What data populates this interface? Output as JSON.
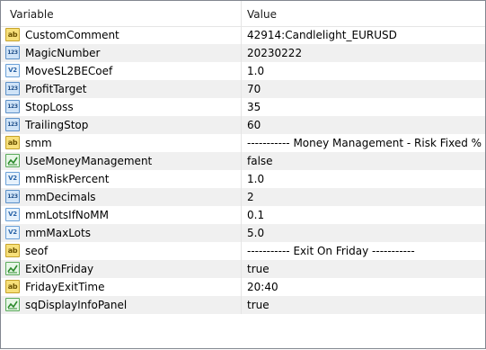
{
  "header": {
    "variable": "Variable",
    "value": "Value"
  },
  "rows": [
    {
      "icon": "string-icon",
      "type": "str",
      "name": "CustomComment",
      "value": "42914:Candlelight_EURUSD"
    },
    {
      "icon": "integer-icon",
      "type": "int",
      "name": "MagicNumber",
      "value": "20230222"
    },
    {
      "icon": "double-icon",
      "type": "dbl",
      "name": "MoveSL2BECoef",
      "value": "1.0"
    },
    {
      "icon": "integer-icon",
      "type": "int",
      "name": "ProfitTarget",
      "value": "70"
    },
    {
      "icon": "integer-icon",
      "type": "int",
      "name": "StopLoss",
      "value": "35"
    },
    {
      "icon": "integer-icon",
      "type": "int",
      "name": "TrailingStop",
      "value": "60"
    },
    {
      "icon": "string-icon",
      "type": "str",
      "name": "smm",
      "value": "----------- Money Management - Risk Fixed % ..."
    },
    {
      "icon": "boolean-icon",
      "type": "bool",
      "name": "UseMoneyManagement",
      "value": "false"
    },
    {
      "icon": "double-icon",
      "type": "dbl",
      "name": "mmRiskPercent",
      "value": "1.0"
    },
    {
      "icon": "integer-icon",
      "type": "int",
      "name": "mmDecimals",
      "value": "2"
    },
    {
      "icon": "double-icon",
      "type": "dbl",
      "name": "mmLotsIfNoMM",
      "value": "0.1"
    },
    {
      "icon": "double-icon",
      "type": "dbl",
      "name": "mmMaxLots",
      "value": "5.0"
    },
    {
      "icon": "string-icon",
      "type": "str",
      "name": "seof",
      "value": "----------- Exit On Friday -----------"
    },
    {
      "icon": "boolean-icon",
      "type": "bool",
      "name": "ExitOnFriday",
      "value": "true"
    },
    {
      "icon": "string-icon",
      "type": "str",
      "name": "FridayExitTime",
      "value": "20:40"
    },
    {
      "icon": "boolean-icon",
      "type": "bool",
      "name": "sqDisplayInfoPanel",
      "value": "true"
    }
  ],
  "icon_glyphs": {
    "str": "ab",
    "int": "123",
    "dbl": "V2"
  }
}
